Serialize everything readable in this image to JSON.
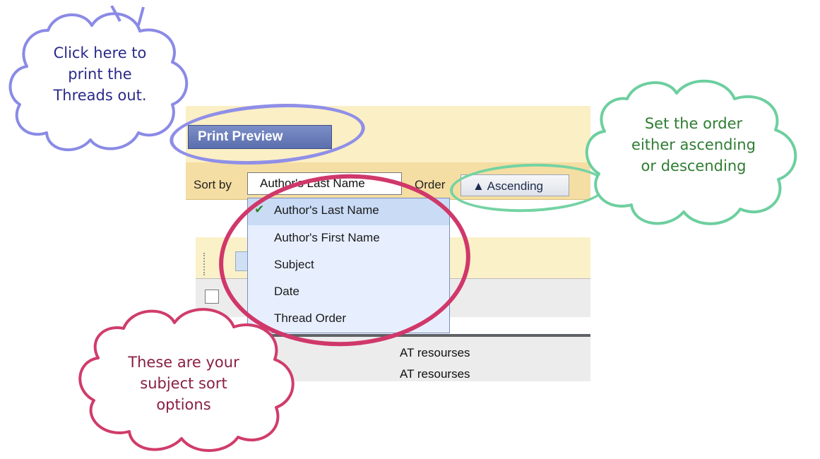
{
  "toolbar": {
    "print_preview_label": "Print Preview"
  },
  "sort": {
    "label": "Sort by",
    "selected_value": "Author's Last Name",
    "order_label": "Order",
    "order_button_label": "▲ Ascending",
    "options": [
      "Author's Last Name",
      "Author's First Name",
      "Subject",
      "Date",
      "Thread Order"
    ],
    "selected_index": 0
  },
  "threads": {
    "rows": [
      "AT resourses",
      "AT resourses"
    ]
  },
  "callouts": {
    "print": {
      "lines": [
        "Click here to",
        "print the",
        "Threads out."
      ],
      "color": "#8a8ae6"
    },
    "order": {
      "lines": [
        "Set the order",
        "either ascending",
        "or descending"
      ],
      "color": "#6dcf9f"
    },
    "sort": {
      "lines": [
        "These are your",
        "subject sort",
        "options"
      ],
      "color": "#d03c6a"
    }
  },
  "colors": {
    "print_ring": "#8f8fe8",
    "order_ring": "#74d3a3",
    "menu_ring": "#d0386a"
  }
}
